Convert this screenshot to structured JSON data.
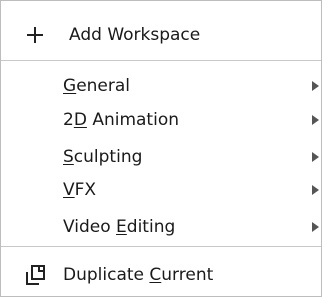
{
  "menu": {
    "add_workspace": {
      "label": "Add Workspace",
      "icon": "plus-icon"
    },
    "templates": [
      {
        "pre": "",
        "key": "G",
        "post": "eneral",
        "arrow": "submenu-arrow-icon"
      },
      {
        "pre": "2",
        "key": "D",
        "post": " Animation",
        "arrow": "submenu-arrow-icon"
      },
      {
        "pre": "",
        "key": "S",
        "post": "culpting",
        "arrow": "submenu-arrow-icon"
      },
      {
        "pre": "",
        "key": "V",
        "post": "FX",
        "arrow": "submenu-arrow-icon"
      },
      {
        "pre": "Video ",
        "key": "E",
        "post": "diting",
        "arrow": "submenu-arrow-icon"
      }
    ],
    "duplicate": {
      "pre": "Duplicate ",
      "key": "C",
      "post": "urrent",
      "icon": "duplicate-icon"
    }
  },
  "colors": {
    "background": "#ffffff",
    "text": "#1a1a1a",
    "separator": "#c8c8c8",
    "arrow": "#555555"
  }
}
